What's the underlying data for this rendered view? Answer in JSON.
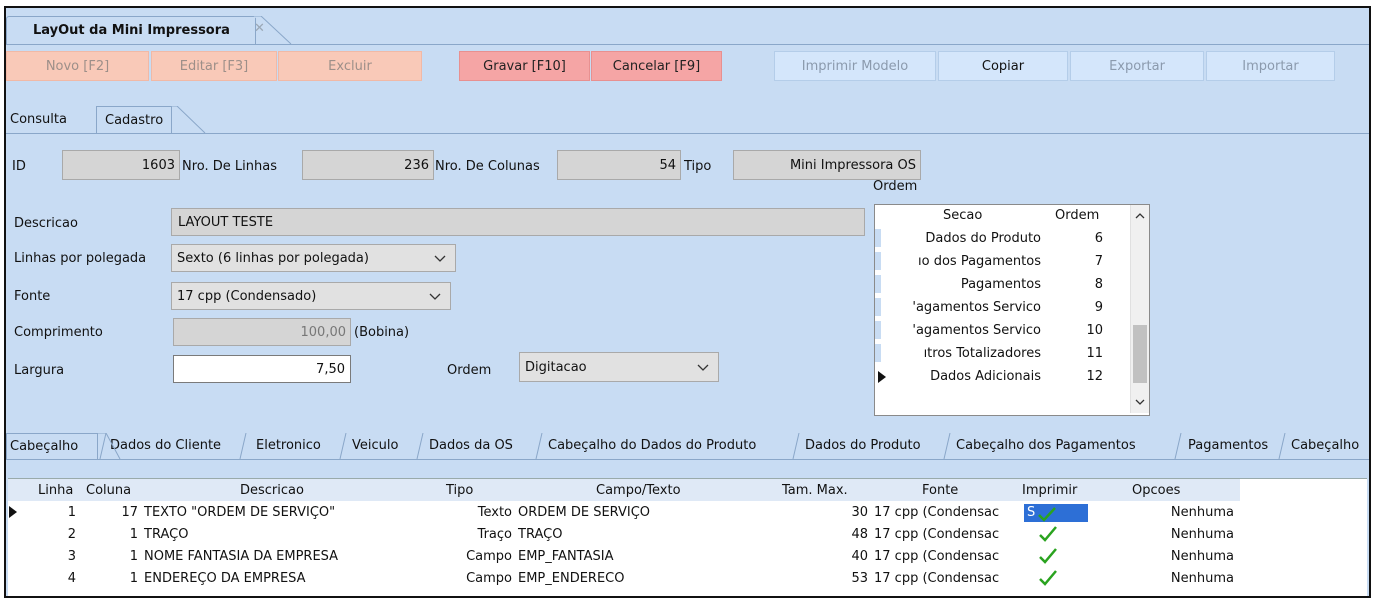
{
  "window": {
    "tab_title": "LayOut da Mini Impressora",
    "close_glyph": "✕"
  },
  "toolbar": {
    "novo": "Novo [F2]",
    "editar": "Editar [F3]",
    "excluir": "Excluir",
    "gravar": "Gravar [F10]",
    "cancelar": "Cancelar [F9]",
    "imprimir": "Imprimir Modelo",
    "copiar": "Copiar",
    "exportar": "Exportar",
    "importar": "Importar"
  },
  "subtabs": {
    "consulta": "Consulta",
    "cadastro": "Cadastro"
  },
  "form": {
    "id_label": "ID",
    "id_value": "1603",
    "nro_linhas_label": "Nro. De Linhas",
    "nro_linhas_value": "236",
    "nro_colunas_label": "Nro. De Colunas",
    "nro_colunas_value": "54",
    "tipo_label": "Tipo",
    "tipo_value": "Mini Impressora OS",
    "descricao_label": "Descricao",
    "descricao_value": "LAYOUT TESTE",
    "linhas_label": "Linhas por polegada",
    "linhas_value": "Sexto  (6 linhas por polegada)",
    "fonte_label": "Fonte",
    "fonte_value": "17 cpp (Condensado)",
    "comprimento_label": "Comprimento",
    "comprimento_value": "100,00",
    "comprimento_unit": "(Bobina)",
    "largura_label": "Largura",
    "largura_value": "7,50",
    "ordem_label": "Ordem",
    "ordem_value": "Digitacao"
  },
  "ordem_panel": {
    "title": "Ordem",
    "headers": {
      "secao": "Secao",
      "ordem": "Ordem"
    },
    "rows": [
      {
        "secao": "Dados do Produto",
        "ordem": "6"
      },
      {
        "secao": "ıo dos Pagamentos",
        "ordem": "7"
      },
      {
        "secao": "Pagamentos",
        "ordem": "8"
      },
      {
        "secao": "'agamentos Servico",
        "ordem": "9"
      },
      {
        "secao": "'agamentos Servico",
        "ordem": "10"
      },
      {
        "secao": "ıtros Totalizadores",
        "ordem": "11"
      },
      {
        "secao": "Dados Adicionais",
        "ordem": "12"
      }
    ]
  },
  "bottom_tabs": [
    "Cabeçalho",
    "Dados do Cliente",
    "Eletronico",
    "Veiculo",
    "Dados da OS",
    "Cabeçalho do Dados do Produto",
    "Dados do Produto",
    "Cabeçalho dos Pagamentos",
    "Pagamentos",
    "Cabeçalho"
  ],
  "grid": {
    "headers": {
      "linha": "Linha",
      "coluna": "Coluna",
      "descricao": "Descricao",
      "tipo": "Tipo",
      "campo": "Campo/Texto",
      "tam": "Tam. Max.",
      "fonte": "Fonte",
      "imprimir": "Imprimir",
      "opcoes": "Opcoes"
    },
    "rows": [
      {
        "linha": "1",
        "coluna": "17",
        "descricao": "TEXTO \"ORDEM DE SERVIÇO\"",
        "tipo": "Texto",
        "campo": "ORDEM DE SERVIÇO",
        "tam": "30",
        "fonte": "17 cpp (Condensac",
        "imprimir": "S",
        "opcoes": "Nenhuma"
      },
      {
        "linha": "2",
        "coluna": "1",
        "descricao": "TRAÇO",
        "tipo": "Traço",
        "campo": "TRAÇO",
        "tam": "48",
        "fonte": "17 cpp (Condensac",
        "imprimir": "",
        "opcoes": "Nenhuma"
      },
      {
        "linha": "3",
        "coluna": "1",
        "descricao": "NOME FANTASIA DA EMPRESA",
        "tipo": "Campo",
        "campo": "EMP_FANTASIA",
        "tam": "40",
        "fonte": "17 cpp (Condensac",
        "imprimir": "",
        "opcoes": "Nenhuma"
      },
      {
        "linha": "4",
        "coluna": "1",
        "descricao": "ENDEREÇO DA EMPRESA",
        "tipo": "Campo",
        "campo": "EMP_ENDERECO",
        "tam": "53",
        "fonte": "17 cpp (Condensac",
        "imprimir": "",
        "opcoes": "Nenhuma"
      }
    ]
  },
  "colors": {
    "background": "#c8dcf3",
    "check": "#2aa31f",
    "selection": "#2d6fd6"
  }
}
